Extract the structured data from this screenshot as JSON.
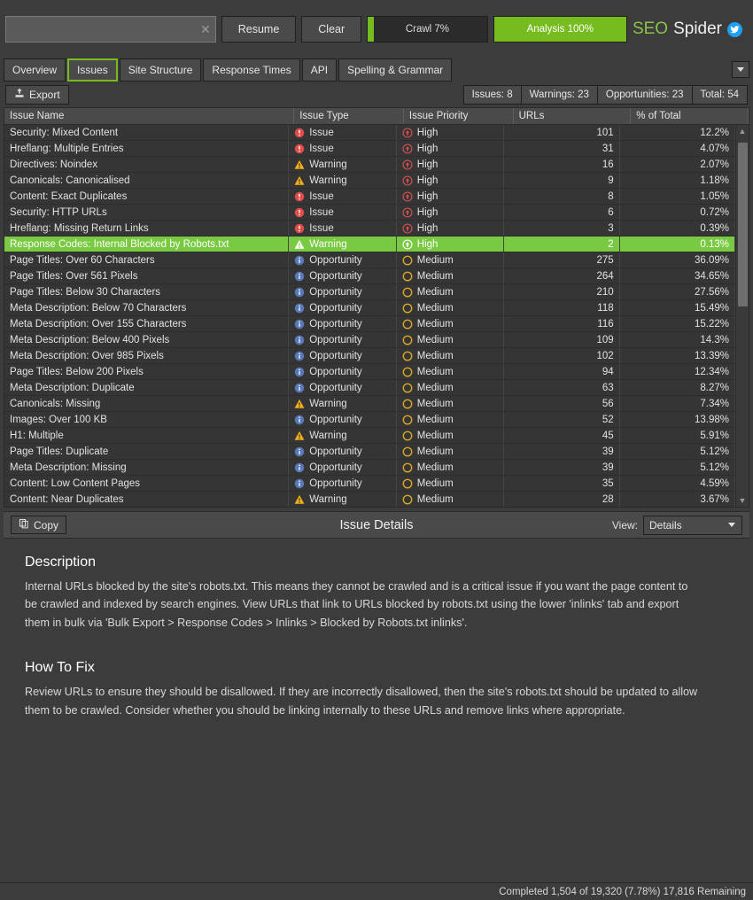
{
  "topbar": {
    "search_value": "",
    "search_placeholder": "",
    "clear_icon": "close-icon",
    "resume_label": "Resume",
    "clear_label": "Clear",
    "crawl_label": "Crawl 7%",
    "crawl_percent": 7,
    "analysis_label": "Analysis 100%",
    "analysis_percent": 100,
    "brand_seo": "SEO",
    "brand_spider": "Spider",
    "twitter_icon": "twitter-icon",
    "green": "#77bc1f"
  },
  "tabs": [
    {
      "label": "Overview",
      "selected": false
    },
    {
      "label": "Issues",
      "selected": true
    },
    {
      "label": "Site Structure",
      "selected": false
    },
    {
      "label": "Response Times",
      "selected": false
    },
    {
      "label": "API",
      "selected": false
    },
    {
      "label": "Spelling & Grammar",
      "selected": false
    }
  ],
  "actionbar": {
    "export_label": "Export",
    "export_icon": "export-icon",
    "counters": [
      {
        "label": "Issues: 8"
      },
      {
        "label": "Warnings: 23"
      },
      {
        "label": "Opportunities: 23"
      },
      {
        "label": "Total: 54"
      }
    ]
  },
  "table": {
    "columns": [
      "Issue Name",
      "Issue Type",
      "Issue Priority",
      "URLs",
      "% of Total"
    ],
    "rows": [
      {
        "name": "Security: Mixed Content",
        "type": "Issue",
        "type_icon": "issue-icon",
        "priority": "High",
        "priority_icon": "high-priority-icon",
        "urls": "101",
        "pct": "12.2%",
        "selected": false
      },
      {
        "name": "Hreflang: Multiple Entries",
        "type": "Issue",
        "type_icon": "issue-icon",
        "priority": "High",
        "priority_icon": "high-priority-icon",
        "urls": "31",
        "pct": "4.07%",
        "selected": false
      },
      {
        "name": "Directives: Noindex",
        "type": "Warning",
        "type_icon": "warning-icon",
        "priority": "High",
        "priority_icon": "high-priority-icon",
        "urls": "16",
        "pct": "2.07%",
        "selected": false
      },
      {
        "name": "Canonicals: Canonicalised",
        "type": "Warning",
        "type_icon": "warning-icon",
        "priority": "High",
        "priority_icon": "high-priority-icon",
        "urls": "9",
        "pct": "1.18%",
        "selected": false
      },
      {
        "name": "Content: Exact Duplicates",
        "type": "Issue",
        "type_icon": "issue-icon",
        "priority": "High",
        "priority_icon": "high-priority-icon",
        "urls": "8",
        "pct": "1.05%",
        "selected": false
      },
      {
        "name": "Security: HTTP URLs",
        "type": "Issue",
        "type_icon": "issue-icon",
        "priority": "High",
        "priority_icon": "high-priority-icon",
        "urls": "6",
        "pct": "0.72%",
        "selected": false
      },
      {
        "name": "Hreflang: Missing Return Links",
        "type": "Issue",
        "type_icon": "issue-icon",
        "priority": "High",
        "priority_icon": "high-priority-icon",
        "urls": "3",
        "pct": "0.39%",
        "selected": false
      },
      {
        "name": "Response Codes: Internal Blocked by Robots.txt",
        "type": "Warning",
        "type_icon": "warning-icon",
        "priority": "High",
        "priority_icon": "high-priority-icon",
        "urls": "2",
        "pct": "0.13%",
        "selected": true
      },
      {
        "name": "Page Titles: Over 60 Characters",
        "type": "Opportunity",
        "type_icon": "opportunity-icon",
        "priority": "Medium",
        "priority_icon": "medium-priority-icon",
        "urls": "275",
        "pct": "36.09%",
        "selected": false
      },
      {
        "name": "Page Titles: Over 561 Pixels",
        "type": "Opportunity",
        "type_icon": "opportunity-icon",
        "priority": "Medium",
        "priority_icon": "medium-priority-icon",
        "urls": "264",
        "pct": "34.65%",
        "selected": false
      },
      {
        "name": "Page Titles: Below 30 Characters",
        "type": "Opportunity",
        "type_icon": "opportunity-icon",
        "priority": "Medium",
        "priority_icon": "medium-priority-icon",
        "urls": "210",
        "pct": "27.56%",
        "selected": false
      },
      {
        "name": "Meta Description: Below 70 Characters",
        "type": "Opportunity",
        "type_icon": "opportunity-icon",
        "priority": "Medium",
        "priority_icon": "medium-priority-icon",
        "urls": "118",
        "pct": "15.49%",
        "selected": false
      },
      {
        "name": "Meta Description: Over 155 Characters",
        "type": "Opportunity",
        "type_icon": "opportunity-icon",
        "priority": "Medium",
        "priority_icon": "medium-priority-icon",
        "urls": "116",
        "pct": "15.22%",
        "selected": false
      },
      {
        "name": "Meta Description: Below 400 Pixels",
        "type": "Opportunity",
        "type_icon": "opportunity-icon",
        "priority": "Medium",
        "priority_icon": "medium-priority-icon",
        "urls": "109",
        "pct": "14.3%",
        "selected": false
      },
      {
        "name": "Meta Description: Over 985 Pixels",
        "type": "Opportunity",
        "type_icon": "opportunity-icon",
        "priority": "Medium",
        "priority_icon": "medium-priority-icon",
        "urls": "102",
        "pct": "13.39%",
        "selected": false
      },
      {
        "name": "Page Titles: Below 200 Pixels",
        "type": "Opportunity",
        "type_icon": "opportunity-icon",
        "priority": "Medium",
        "priority_icon": "medium-priority-icon",
        "urls": "94",
        "pct": "12.34%",
        "selected": false
      },
      {
        "name": "Meta Description: Duplicate",
        "type": "Opportunity",
        "type_icon": "opportunity-icon",
        "priority": "Medium",
        "priority_icon": "medium-priority-icon",
        "urls": "63",
        "pct": "8.27%",
        "selected": false
      },
      {
        "name": "Canonicals: Missing",
        "type": "Warning",
        "type_icon": "warning-icon",
        "priority": "Medium",
        "priority_icon": "medium-priority-icon",
        "urls": "56",
        "pct": "7.34%",
        "selected": false
      },
      {
        "name": "Images: Over 100 KB",
        "type": "Opportunity",
        "type_icon": "opportunity-icon",
        "priority": "Medium",
        "priority_icon": "medium-priority-icon",
        "urls": "52",
        "pct": "13.98%",
        "selected": false
      },
      {
        "name": "H1: Multiple",
        "type": "Warning",
        "type_icon": "warning-icon",
        "priority": "Medium",
        "priority_icon": "medium-priority-icon",
        "urls": "45",
        "pct": "5.91%",
        "selected": false
      },
      {
        "name": "Page Titles: Duplicate",
        "type": "Opportunity",
        "type_icon": "opportunity-icon",
        "priority": "Medium",
        "priority_icon": "medium-priority-icon",
        "urls": "39",
        "pct": "5.12%",
        "selected": false
      },
      {
        "name": "Meta Description: Missing",
        "type": "Opportunity",
        "type_icon": "opportunity-icon",
        "priority": "Medium",
        "priority_icon": "medium-priority-icon",
        "urls": "39",
        "pct": "5.12%",
        "selected": false
      },
      {
        "name": "Content: Low Content Pages",
        "type": "Opportunity",
        "type_icon": "opportunity-icon",
        "priority": "Medium",
        "priority_icon": "medium-priority-icon",
        "urls": "35",
        "pct": "4.59%",
        "selected": false
      },
      {
        "name": "Content: Near Duplicates",
        "type": "Warning",
        "type_icon": "warning-icon",
        "priority": "Medium",
        "priority_icon": "medium-priority-icon",
        "urls": "28",
        "pct": "3.67%",
        "selected": false
      }
    ]
  },
  "details": {
    "copy_label": "Copy",
    "copy_icon": "copy-icon",
    "title": "Issue Details",
    "view_label": "View:",
    "view_value": "Details",
    "sections": [
      {
        "heading": "Description",
        "body": "Internal URLs blocked by the site's robots.txt. This means they cannot be crawled and is a critical issue if you want the page content to be crawled and indexed by search engines. View URLs that link to URLs blocked by robots.txt using the lower 'inlinks' tab and export them in bulk via 'Bulk Export > Response Codes > Inlinks > Blocked by Robots.txt inlinks'."
      },
      {
        "heading": "How To Fix",
        "body": "Review URLs to ensure they should be disallowed. If they are incorrectly disallowed, then the site's robots.txt should be updated to allow them to be crawled. Consider whether you should be linking internally to these URLs and remove links where appropriate."
      }
    ]
  },
  "statusbar": {
    "text": "Completed 1,504 of 19,320 (7.78%) 17,816 Remaining"
  }
}
